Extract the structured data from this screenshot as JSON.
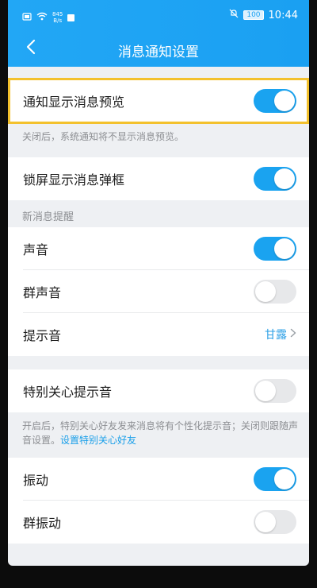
{
  "status_bar": {
    "speed_top": "845",
    "speed_bottom": "B/s",
    "battery": "100",
    "time": "10:44"
  },
  "nav": {
    "title": "消息通知设置"
  },
  "settings": {
    "preview": {
      "label": "通知显示消息预览",
      "on": true
    },
    "preview_note": "关闭后，系统通知将不显示消息预览。",
    "lock_popup": {
      "label": "锁屏显示消息弹框",
      "on": true
    },
    "section_title": "新消息提醒",
    "sound": {
      "label": "声音",
      "on": true
    },
    "group_sound": {
      "label": "群声音",
      "on": false
    },
    "tone": {
      "label": "提示音",
      "value": "甘露"
    },
    "special_tone": {
      "label": "特别关心提示音",
      "on": false
    },
    "special_note": "开启后，特别关心好友发来消息将有个性化提示音；关闭则跟随声音设置。",
    "special_link": "设置特别关心好友",
    "vibrate": {
      "label": "振动",
      "on": true
    },
    "group_vibrate": {
      "label": "群振动",
      "on": false
    }
  },
  "colors": {
    "accent": "#1aa3f0",
    "highlight": "#f3c12d",
    "header": "#1aa0f2"
  },
  "icons": [
    "back-arrow-icon",
    "wifi-icon",
    "sim-icon",
    "mute-icon",
    "chevron-right-icon"
  ]
}
